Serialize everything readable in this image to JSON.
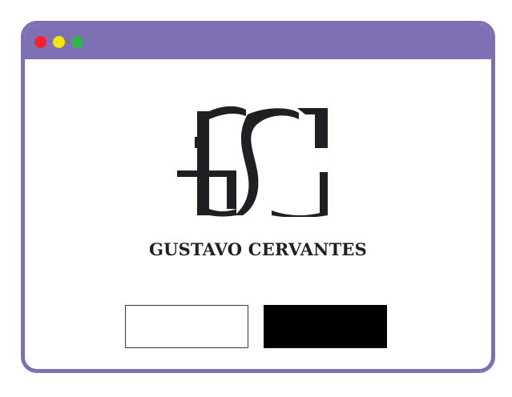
{
  "window": {
    "frame_color": "#7e70b3",
    "controls": [
      "close-dot",
      "minimize-dot",
      "maximize-dot"
    ],
    "control_colors": [
      "#f5222d",
      "#f2e900",
      "#2fb84a"
    ]
  },
  "logo": {
    "monogram": "GC",
    "brand_name": "GUSTAVO CERVANTES",
    "color": "#1f1f24"
  },
  "buttons": {
    "left_label": "",
    "right_label": "",
    "left_color": "#ffffff",
    "right_color": "#000000"
  }
}
